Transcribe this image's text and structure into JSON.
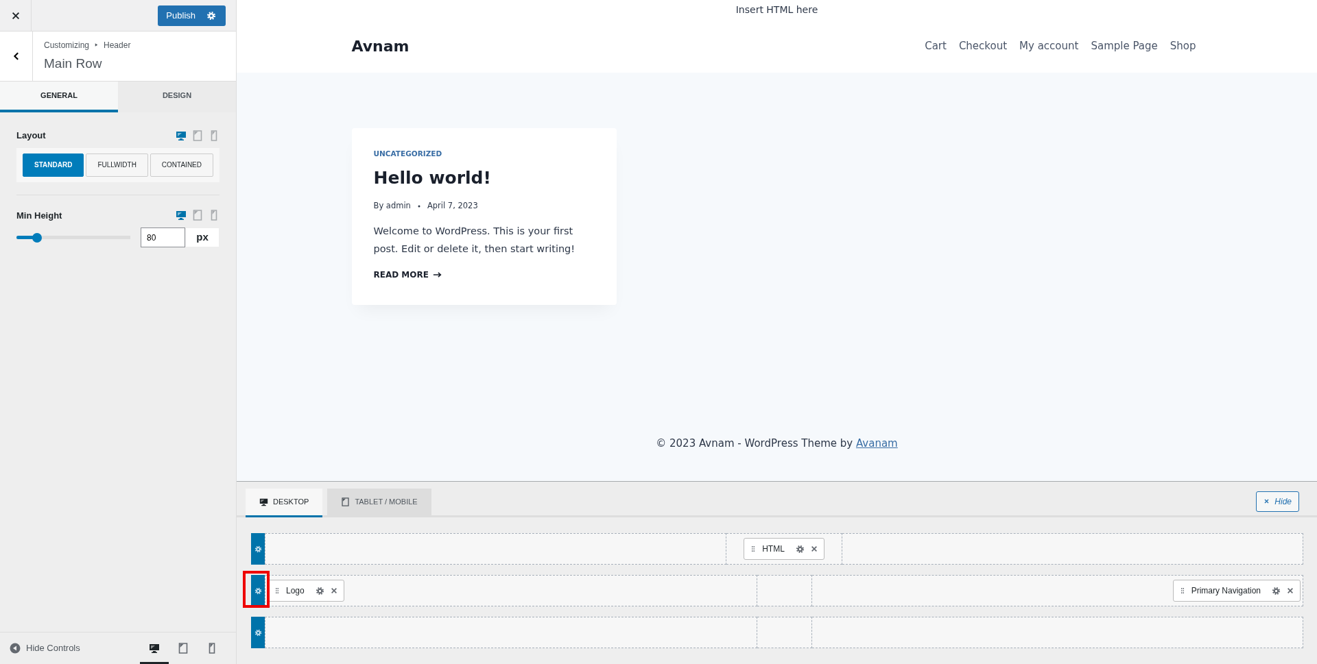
{
  "sidebar": {
    "publish_button": "Publish",
    "breadcrumb": {
      "parent": "Customizing",
      "section": "Header"
    },
    "title": "Main Row",
    "tabs": [
      {
        "label": "GENERAL",
        "selected": true
      },
      {
        "label": "DESIGN",
        "selected": false
      }
    ],
    "layout": {
      "label": "Layout",
      "devices": [
        {
          "kind": "desktop",
          "selected": true
        },
        {
          "kind": "tablet",
          "selected": false
        },
        {
          "kind": "mobile",
          "selected": false
        }
      ],
      "options": [
        {
          "label": "STANDARD",
          "selected": true
        },
        {
          "label": "FULLWIDTH",
          "selected": false
        },
        {
          "label": "CONTAINED",
          "selected": false
        }
      ]
    },
    "min_height": {
      "label": "Min Height",
      "devices": [
        {
          "kind": "desktop",
          "selected": true
        },
        {
          "kind": "tablet",
          "selected": false
        },
        {
          "kind": "mobile",
          "selected": false
        }
      ],
      "level": 0.18,
      "value": "80",
      "unit": "px"
    },
    "footer": {
      "hide_controls": "Hide Controls",
      "devices": [
        {
          "kind": "desktop",
          "selected": true
        },
        {
          "kind": "tablet",
          "selected": false
        },
        {
          "kind": "mobile",
          "selected": false
        }
      ]
    }
  },
  "preview": {
    "top_html": "Insert HTML here",
    "site_title": "Avnam",
    "nav": [
      "Cart",
      "Checkout",
      "My account",
      "Sample Page",
      "Shop"
    ],
    "post": {
      "category": "UNCATEGORIZED",
      "title": "Hello world!",
      "author": "By admin",
      "date": "April 7, 2023",
      "excerpt": "Welcome to WordPress. This is your first post. Edit or delete it, then start writing!",
      "read_more": "READ MORE"
    },
    "footer": {
      "text": "© 2023 Avnam - WordPress Theme by",
      "link": "Avanam"
    }
  },
  "builder": {
    "tabs": [
      {
        "label": "DESKTOP",
        "kind": "desktop",
        "selected": true
      },
      {
        "label": "TABLET / MOBILE",
        "kind": "tablet",
        "selected": false
      }
    ],
    "hide_button": "Hide",
    "rows": [
      {
        "zones": {
          "center": [
            {
              "label": "HTML"
            }
          ]
        }
      },
      {
        "highlighted": true,
        "zones": {
          "left": [
            {
              "label": "Logo"
            }
          ],
          "right": [
            {
              "label": "Primary Navigation"
            }
          ]
        }
      },
      {
        "zones": {}
      }
    ]
  }
}
